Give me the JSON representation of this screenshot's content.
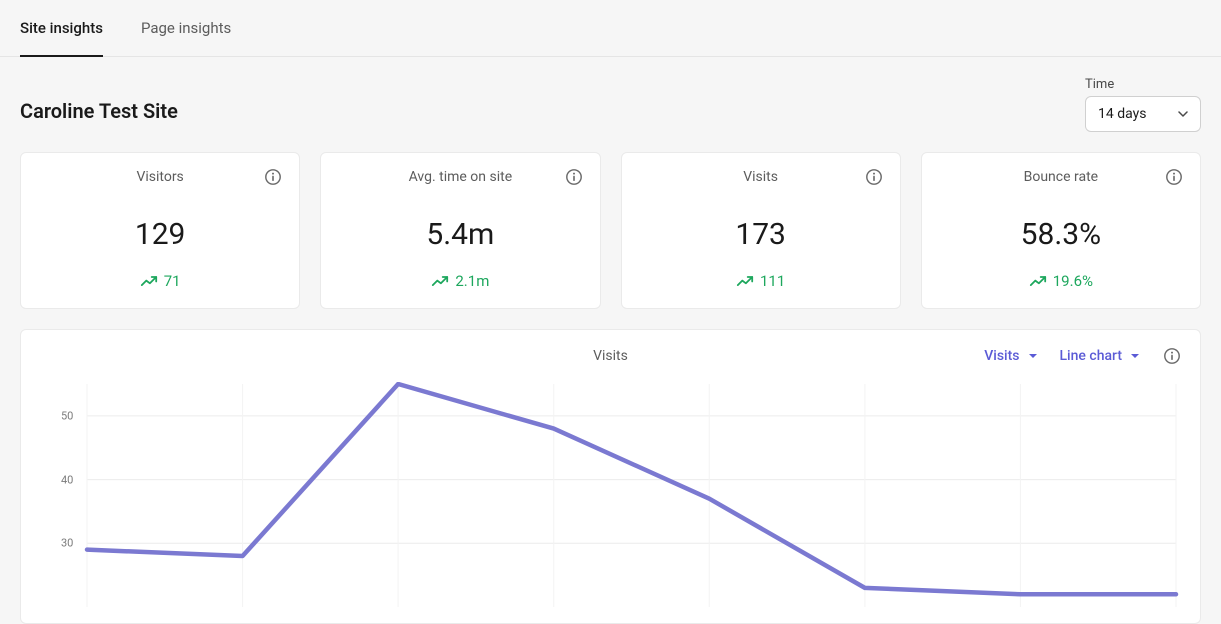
{
  "tabs": {
    "site": "Site insights",
    "page": "Page insights"
  },
  "page_title": "Caroline Test Site",
  "time": {
    "label": "Time",
    "value": "14 days"
  },
  "metrics": {
    "visitors": {
      "title": "Visitors",
      "value": "129",
      "delta": "71"
    },
    "avg_time": {
      "title": "Avg. time on site",
      "value": "5.4m",
      "delta": "2.1m"
    },
    "visits": {
      "title": "Visits",
      "value": "173",
      "delta": "111"
    },
    "bounce": {
      "title": "Bounce rate",
      "value": "58.3%",
      "delta": "19.6%"
    }
  },
  "chart": {
    "title": "Visits",
    "metric_dropdown": "Visits",
    "type_dropdown": "Line chart",
    "y_ticks": {
      "30": "30",
      "40": "40",
      "50": "50"
    }
  },
  "chart_data": {
    "type": "line",
    "title": "Visits",
    "xlabel": "",
    "ylabel": "",
    "ylim": [
      20,
      55
    ],
    "x": [
      1,
      2,
      3,
      4,
      5,
      6,
      7,
      8
    ],
    "values": [
      29,
      28,
      55,
      48,
      37,
      23,
      22,
      22
    ],
    "series_name": "Visits"
  },
  "colors": {
    "line": "#7b79d1",
    "trend": "#1da75d",
    "accent_text": "#5b5bd6"
  }
}
